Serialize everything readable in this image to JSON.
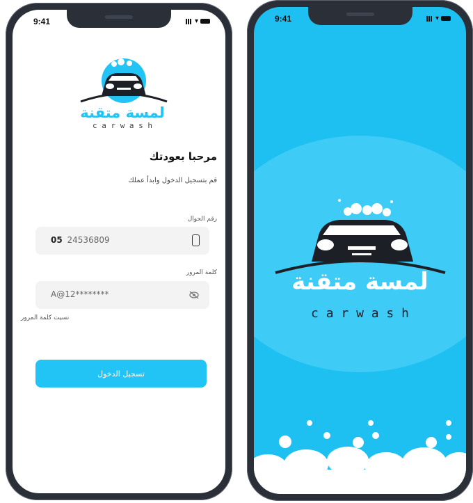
{
  "status": {
    "time": "9:41"
  },
  "brand": {
    "arabic": "لمسة متقنة",
    "english": "c a r w a s h"
  },
  "login": {
    "heading": "مرحبا بعودتك",
    "subtitle": "قم بتسجيل الدخول وابدأ عملك",
    "phone_label": "رقم الجوال",
    "phone_prefix": "05",
    "phone_value": "24536809",
    "password_label": "كلمة المرور",
    "password_value": "A@12********",
    "forgot_label": "نسيت كلمة المرور",
    "submit_label": "تسجيل الدخول"
  },
  "colors": {
    "accent": "#22c3f5",
    "splash_bg": "#1ec0f2",
    "splash_circle": "#3ecbf5",
    "dark": "#1c1f26"
  },
  "icons": [
    "phone-icon",
    "eye-off-icon",
    "signal-icon",
    "wifi-icon",
    "battery-icon",
    "car-logo-icon"
  ]
}
